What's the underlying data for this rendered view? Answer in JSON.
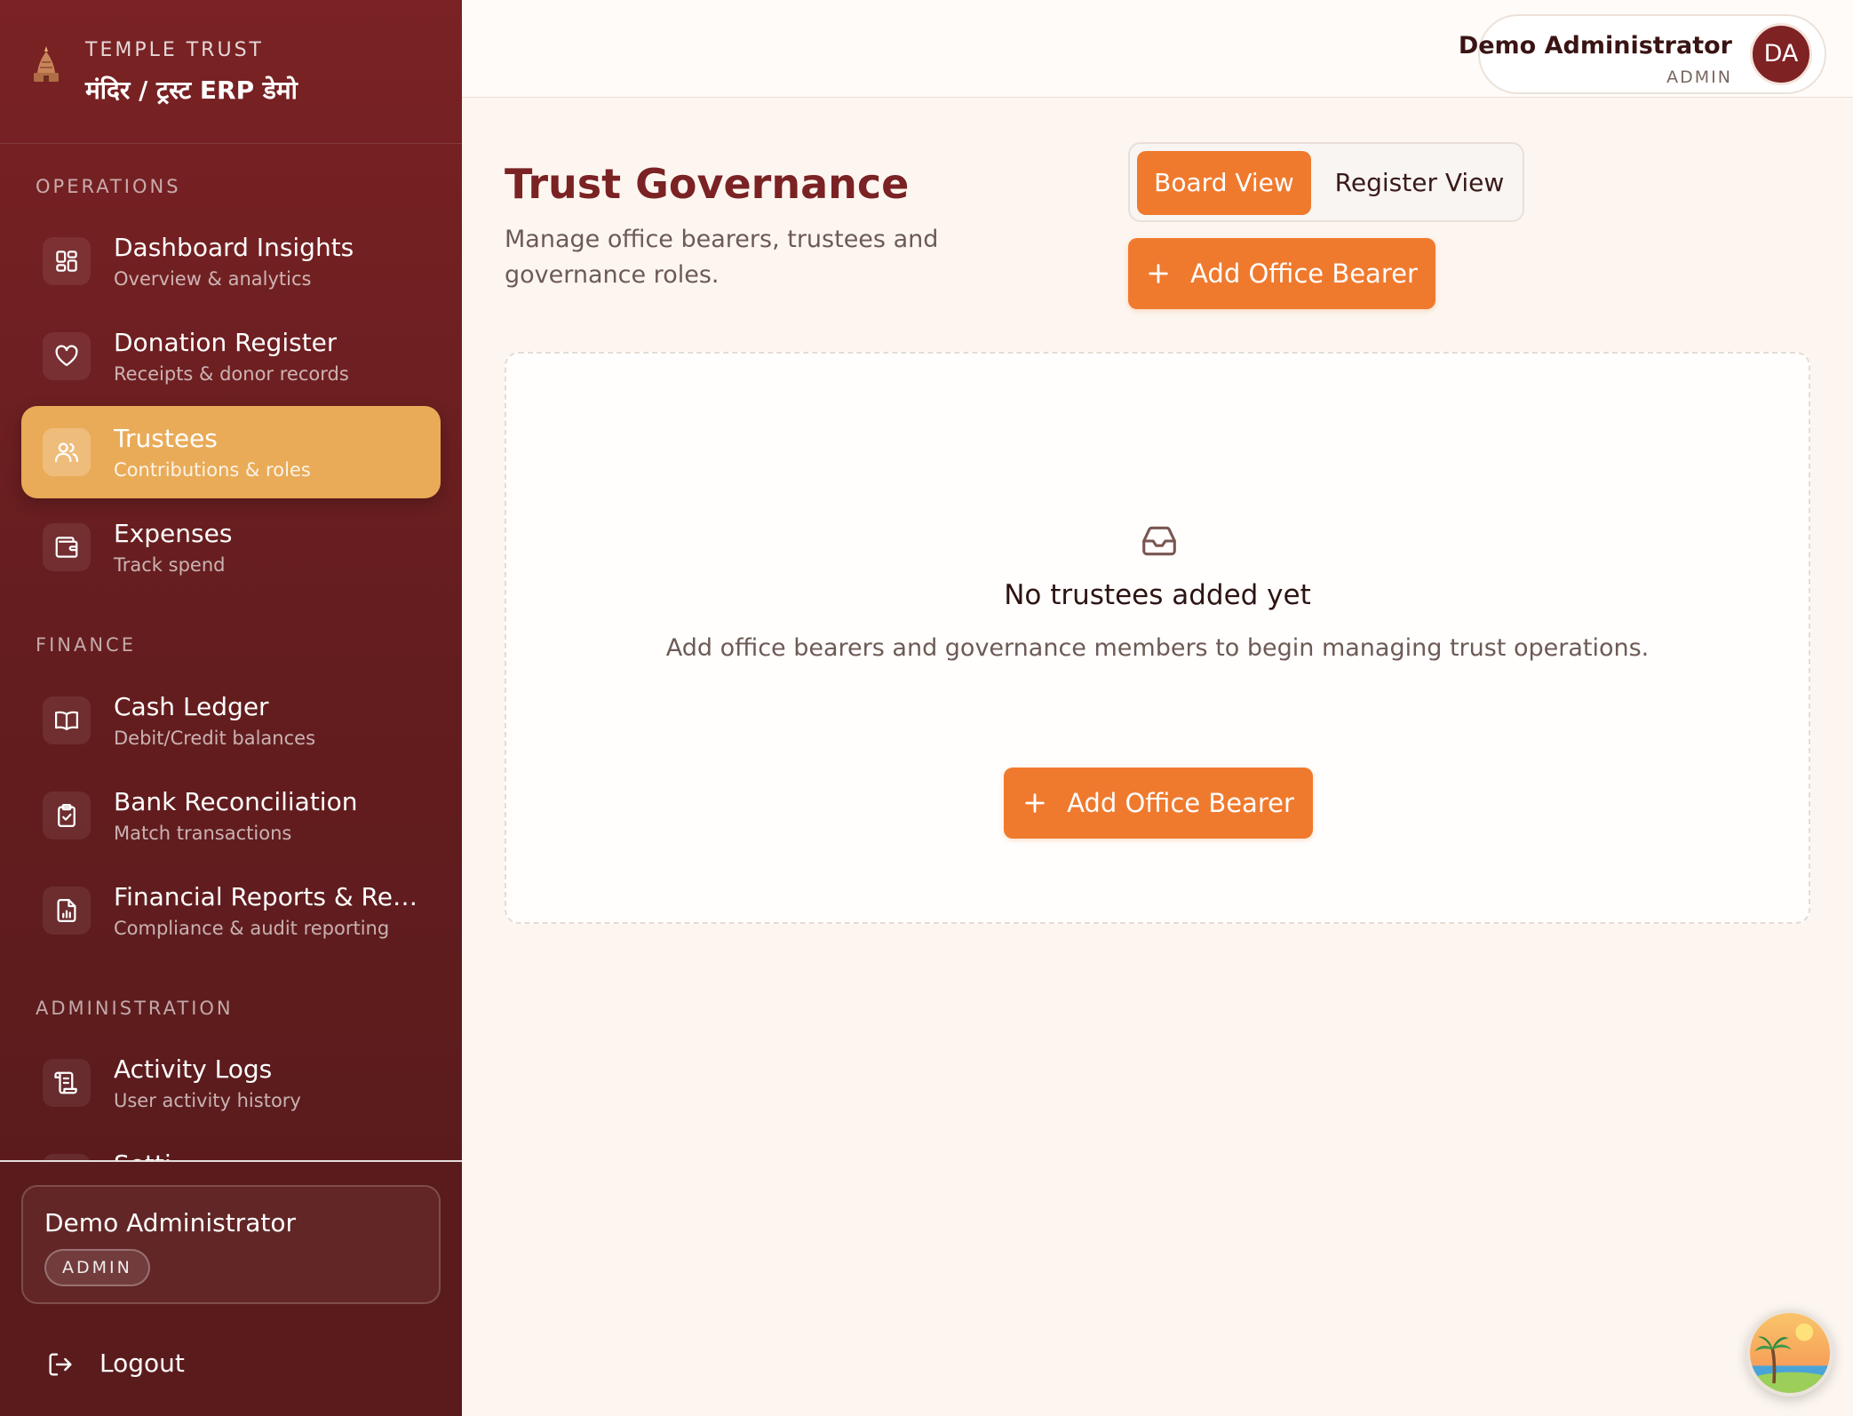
{
  "brand": {
    "kicker": "TEMPLE TRUST",
    "title": "मंदिर / ट्रस्ट ERP डेमो"
  },
  "sidebar": {
    "sections": [
      {
        "title": "OPERATIONS",
        "items": [
          {
            "label": "Dashboard Insights",
            "sub": "Overview & analytics",
            "icon": "grid-icon"
          },
          {
            "label": "Donation Register",
            "sub": "Receipts & donor records",
            "icon": "heart-icon"
          },
          {
            "label": "Trustees",
            "sub": "Contributions & roles",
            "icon": "users-icon",
            "active": true
          },
          {
            "label": "Expenses",
            "sub": "Track spend",
            "icon": "wallet-icon"
          }
        ]
      },
      {
        "title": "FINANCE",
        "items": [
          {
            "label": "Cash Ledger",
            "sub": "Debit/Credit balances",
            "icon": "book-icon"
          },
          {
            "label": "Bank Reconciliation",
            "sub": "Match transactions",
            "icon": "clipboard-check-icon"
          },
          {
            "label": "Financial Reports & Regi...",
            "sub": "Compliance & audit reporting",
            "icon": "file-chart-icon"
          }
        ]
      },
      {
        "title": "ADMINISTRATION",
        "items": [
          {
            "label": "Activity Logs",
            "sub": "User activity history",
            "icon": "scroll-icon"
          },
          {
            "label": "Setti...",
            "sub": "",
            "icon": "settings-icon"
          }
        ]
      }
    ],
    "user": {
      "name": "Demo Administrator",
      "role": "ADMIN"
    },
    "logout_label": "Logout"
  },
  "topbar": {
    "user_name": "Demo Administrator",
    "user_role": "ADMIN",
    "avatar_initials": "DA"
  },
  "main": {
    "title": "Trust Governance",
    "description": "Manage office bearers, trustees and governance roles.",
    "view_toggle": {
      "options": [
        "Board View",
        "Register View"
      ],
      "selected": "Board View"
    },
    "add_button_label": "Add Office Bearer",
    "empty_state": {
      "title": "No trustees added yet",
      "description": "Add office bearers and governance members to begin managing trust operations.",
      "button_label": "Add Office Bearer"
    }
  },
  "colors": {
    "sidebar": "#6e1f21",
    "accent": "#ef7a2e",
    "active_item": "#e9ab58",
    "title": "#7a2224",
    "background": "#fdf6f0"
  }
}
